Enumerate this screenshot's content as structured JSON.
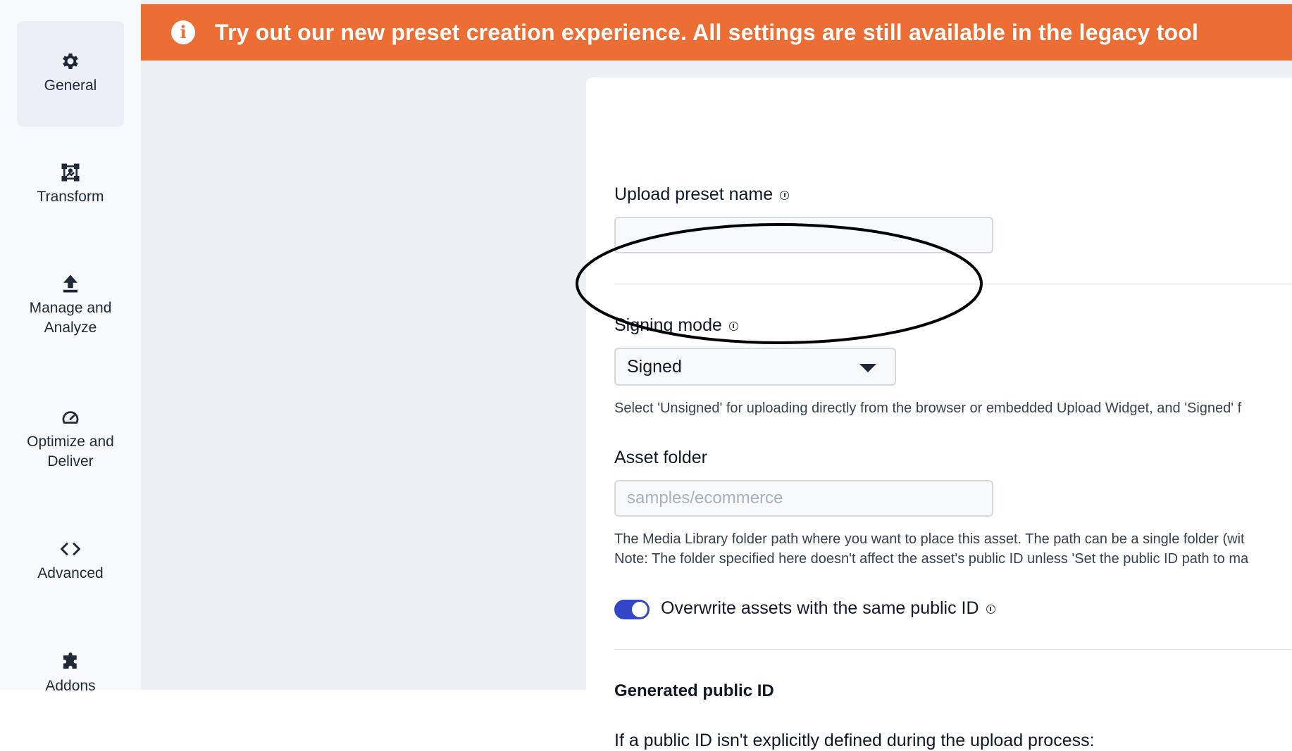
{
  "sidebar": {
    "items": [
      {
        "label": "General",
        "icon": "gear-icon",
        "active": true
      },
      {
        "label": "Transform",
        "icon": "transform-icon",
        "active": false
      },
      {
        "label": "Manage and\nAnalyze",
        "icon": "upload-icon",
        "active": false
      },
      {
        "label": "Optimize and\nDeliver",
        "icon": "gauge-icon",
        "active": false
      },
      {
        "label": "Advanced",
        "icon": "code-icon",
        "active": false
      },
      {
        "label": "Addons",
        "icon": "puzzle-icon",
        "active": false
      }
    ]
  },
  "banner": {
    "text": "Try out our new preset creation experience. All settings are still available in the legacy tool",
    "color": "#ed6e34"
  },
  "form": {
    "preset_name": {
      "label": "Upload preset name",
      "value": ""
    },
    "signing_mode": {
      "label": "Signing mode",
      "value": "Signed",
      "help": "Select 'Unsigned' for uploading directly from the browser or embedded Upload Widget, and 'Signed' f"
    },
    "asset_folder": {
      "label": "Asset folder",
      "placeholder": "samples/ecommerce",
      "help_line1": "The Media Library folder path where you want to place this asset. The path can be a single folder (wit",
      "help_line2": "Note: The folder specified here doesn't affect the asset's public ID unless 'Set the public ID path to ma"
    },
    "overwrite": {
      "label": "Overwrite assets with the same public ID",
      "enabled": true
    },
    "generated_public_id": {
      "title": "Generated public ID",
      "text": "If a public ID isn't explicitly defined during the upload process:"
    }
  },
  "colors": {
    "accent": "#3346c7",
    "banner": "#ed6e34"
  }
}
